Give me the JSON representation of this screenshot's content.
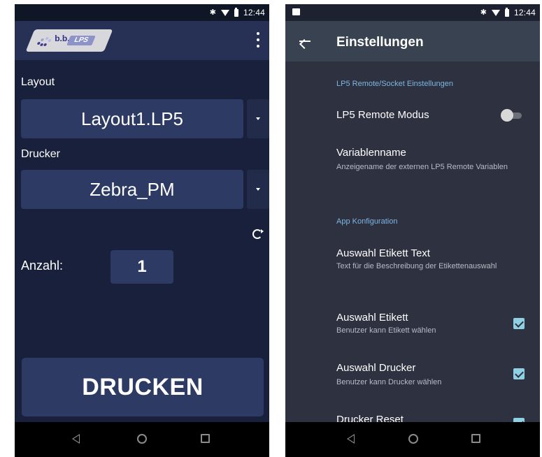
{
  "left_screen": {
    "status": {
      "time": "12:44"
    },
    "logo": {
      "prefix": "b.b.",
      "badge": "LPS"
    },
    "layout": {
      "label": "Layout",
      "value": "Layout1.LP5"
    },
    "printer": {
      "label": "Drucker",
      "value": "Zebra_PM"
    },
    "quantity": {
      "label": "Anzahl:",
      "value": "1"
    },
    "print_button": "DRUCKEN"
  },
  "right_screen": {
    "status": {
      "time": "12:44"
    },
    "title": "Einstellungen",
    "sections": [
      {
        "header": "LP5 Remote/Socket Einstellungen",
        "items": [
          {
            "title": "LP5 Remote Modus",
            "widget": "toggle",
            "checked": false
          },
          {
            "title": "Variablenname",
            "summary": "Anzeigename der externen LP5 Remote Variablen"
          }
        ]
      },
      {
        "header": "App Konfiguration",
        "items": [
          {
            "title": "Auswahl Etikett Text",
            "summary": "Text für die Beschreibung der Etikettenauswahl"
          },
          {
            "title": "Auswahl Etikett",
            "summary": "Benutzer kann Etikett wählen",
            "widget": "checkbox",
            "checked": true
          },
          {
            "title": "Auswahl Drucker",
            "summary": "Benutzer kann Drucker wählen",
            "widget": "checkbox",
            "checked": true
          },
          {
            "title": "Drucker Reset",
            "widget": "checkbox",
            "checked": true
          }
        ]
      }
    ]
  },
  "colors": {
    "left_background": "#18203b",
    "left_control": "#2c3a64",
    "right_background": "#2d3140",
    "accent": "#7fb6e2",
    "checkbox": "#8fd0e3"
  },
  "icons": [
    "bluetooth-icon",
    "wifi-icon",
    "battery-icon",
    "overflow-menu-icon",
    "refresh-icon",
    "back-arrow-icon",
    "nav-back-icon",
    "nav-home-icon",
    "nav-recents-icon"
  ]
}
